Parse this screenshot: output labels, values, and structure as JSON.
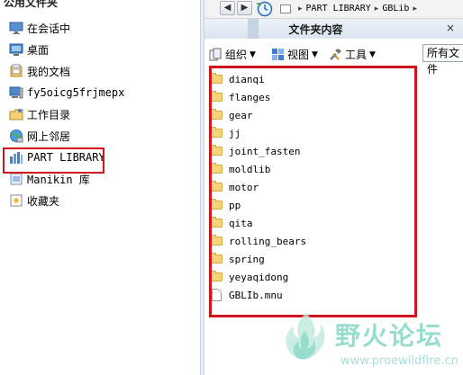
{
  "left_panel": {
    "title": "公用文件夹",
    "items": [
      {
        "label": "在会话中",
        "icon": "monitor-icon"
      },
      {
        "label": "桌面",
        "icon": "desktop-icon"
      },
      {
        "label": "我的文档",
        "icon": "documents-icon"
      },
      {
        "label": "fy5oicg5frjmepx",
        "icon": "computer-icon"
      },
      {
        "label": "工作目录",
        "icon": "working-folder-icon"
      },
      {
        "label": "网上邻居",
        "icon": "network-icon"
      },
      {
        "label": "PART LIBRARY",
        "icon": "part-library-icon"
      },
      {
        "label": "Manikin 库",
        "icon": "manikin-library-icon"
      },
      {
        "label": "收藏夹",
        "icon": "favorites-icon"
      }
    ]
  },
  "navigation": {
    "back_label": "◀",
    "forward_label": "▶",
    "breadcrumb": [
      "PART LIBRARY",
      "GBLib"
    ],
    "separator": "▸"
  },
  "header": {
    "title": "文件夹内容",
    "close_label": "×"
  },
  "toolbar": {
    "organize_label": "组织",
    "view_label": "视图",
    "tools_label": "工具",
    "filter_value": "所有文件"
  },
  "files": [
    {
      "name": "dianqi",
      "type": "folder"
    },
    {
      "name": "flanges",
      "type": "folder"
    },
    {
      "name": "gear",
      "type": "folder"
    },
    {
      "name": "jj",
      "type": "folder"
    },
    {
      "name": "joint_fasten",
      "type": "folder"
    },
    {
      "name": "moldlib",
      "type": "folder"
    },
    {
      "name": "motor",
      "type": "folder"
    },
    {
      "name": "pp",
      "type": "folder"
    },
    {
      "name": "qita",
      "type": "folder"
    },
    {
      "name": "rolling_bears",
      "type": "folder"
    },
    {
      "name": "spring",
      "type": "folder"
    },
    {
      "name": "yeyaqidong",
      "type": "folder"
    },
    {
      "name": "GBLIb.mnu",
      "type": "file"
    }
  ],
  "watermark": {
    "text": "野火论坛",
    "url": "www.proewildfire.cn"
  },
  "colors": {
    "highlight": "#d2141b",
    "folder": "#f6d47a",
    "header_bg": "#dbe4ef"
  }
}
